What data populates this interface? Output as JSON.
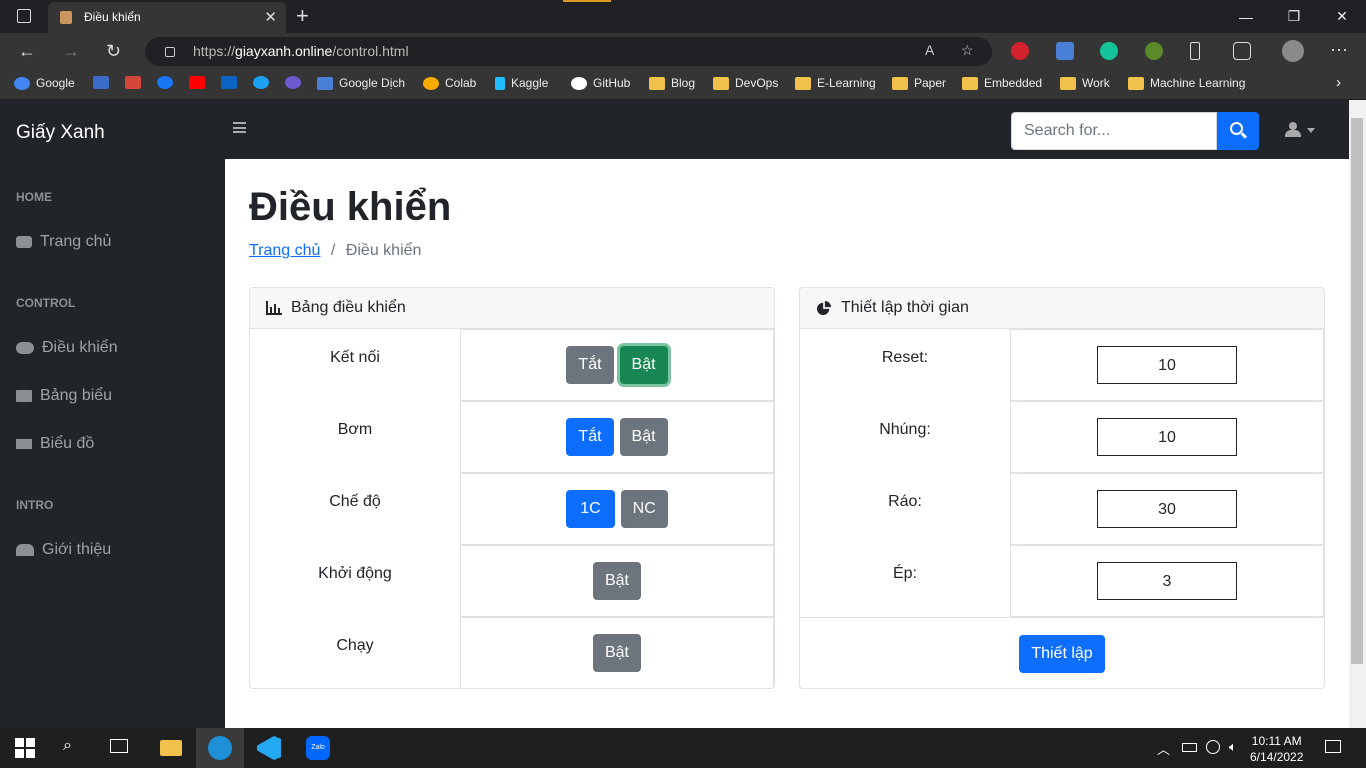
{
  "browser": {
    "tab_title": "Điều khiển",
    "url_prefix": "https://",
    "url_domain": "giayxanh.online",
    "url_path": "/control.html",
    "bookmarks": [
      "Google",
      "Google Dịch",
      "Colab",
      "Kaggle",
      "GitHub",
      "Blog",
      "DevOps",
      "E-Learning",
      "Paper",
      "Embedded",
      "Work",
      "Machine Learning"
    ]
  },
  "app": {
    "brand": "Giấy Xanh",
    "search_placeholder": "Search for...",
    "sidebar": {
      "home_heading": "HOME",
      "home_item": "Trang chủ",
      "control_heading": "CONTROL",
      "control_items": [
        "Điều khiển",
        "Bảng biểu",
        "Biểu đồ"
      ],
      "intro_heading": "INTRO",
      "intro_item": "Giới thiệu"
    },
    "page_title": "Điều khiển",
    "breadcrumb": {
      "home": "Trang chủ",
      "sep": "/",
      "current": "Điều khiển"
    },
    "control_card": {
      "title": "Bảng điều khiển",
      "rows": [
        {
          "label": "Kết nối",
          "buttons": [
            "Tắt",
            "Bật"
          ]
        },
        {
          "label": "Bơm",
          "buttons": [
            "Tắt",
            "Bật"
          ]
        },
        {
          "label": "Chế độ",
          "buttons": [
            "1C",
            "NC"
          ]
        },
        {
          "label": "Khởi động",
          "buttons": [
            "Bật"
          ]
        },
        {
          "label": "Chạy",
          "buttons": [
            "Bật"
          ]
        }
      ]
    },
    "time_card": {
      "title": "Thiết lập thời gian",
      "rows": [
        {
          "label": "Reset:",
          "value": "10"
        },
        {
          "label": "Nhúng:",
          "value": "10"
        },
        {
          "label": "Ráo:",
          "value": "30"
        },
        {
          "label": "Ép:",
          "value": "3"
        }
      ],
      "submit": "Thiết lập"
    }
  },
  "taskbar": {
    "time": "10:11 AM",
    "date": "6/14/2022",
    "zalo": "Zalo"
  }
}
